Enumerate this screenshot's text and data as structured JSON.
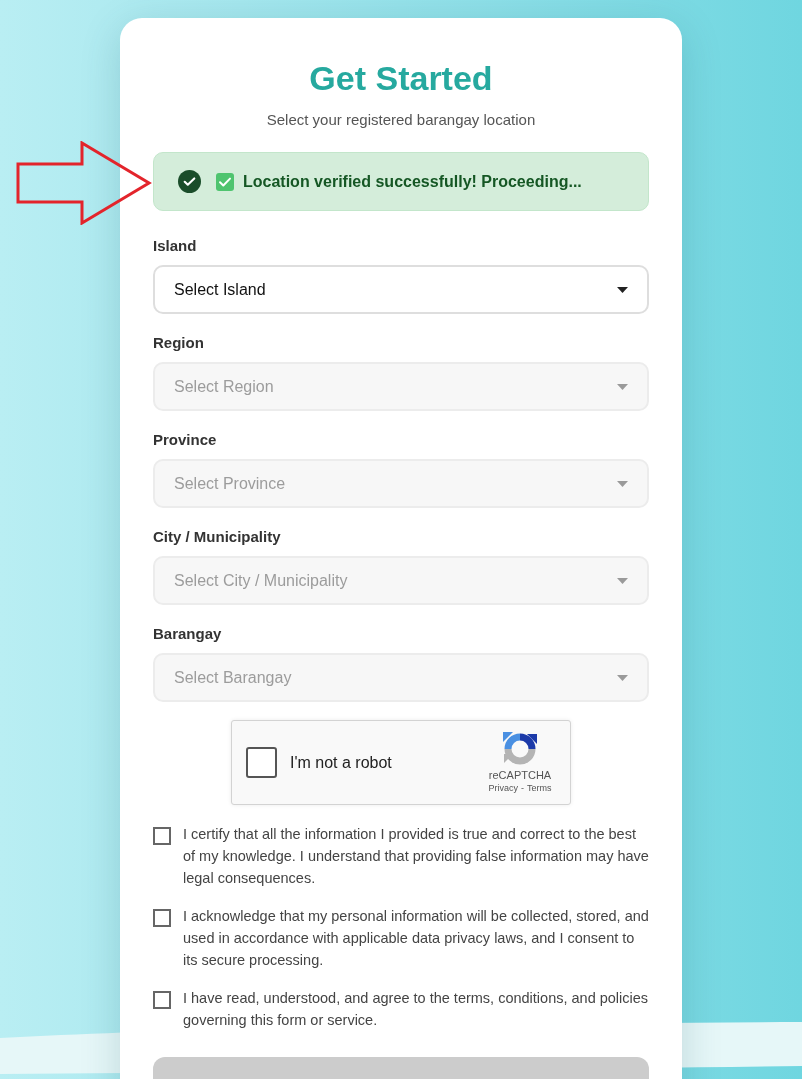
{
  "header": {
    "title": "Get Started",
    "subtitle": "Select your registered barangay location"
  },
  "alert": {
    "kind": "success",
    "message": "Location verified successfully! Proceeding..."
  },
  "fields": [
    {
      "label": "Island",
      "placeholder": "Select Island",
      "disabled": false
    },
    {
      "label": "Region",
      "placeholder": "Select Region",
      "disabled": true
    },
    {
      "label": "Province",
      "placeholder": "Select Province",
      "disabled": true
    },
    {
      "label": "City / Municipality",
      "placeholder": "Select City / Municipality",
      "disabled": true
    },
    {
      "label": "Barangay",
      "placeholder": "Select Barangay",
      "disabled": true
    }
  ],
  "captcha": {
    "label": "I'm not a robot",
    "checked": false,
    "brand": "reCAPTCHA",
    "links": [
      "Privacy",
      "Terms"
    ],
    "separator": "-"
  },
  "agreements": [
    {
      "text": "I certify that all the information I provided is true and correct to the best of my knowledge. I understand that providing false information may have legal consequences.",
      "checked": false
    },
    {
      "text": "I acknowledge that my personal information will be collected, stored, and used in accordance with applicable data privacy laws, and I consent to its secure processing.",
      "checked": false
    },
    {
      "text": "I have read, understood, and agree to the terms, conditions, and policies governing this form or service.",
      "checked": false
    }
  ],
  "button": {
    "disabled": true
  },
  "annotation": {
    "kind": "arrow"
  }
}
